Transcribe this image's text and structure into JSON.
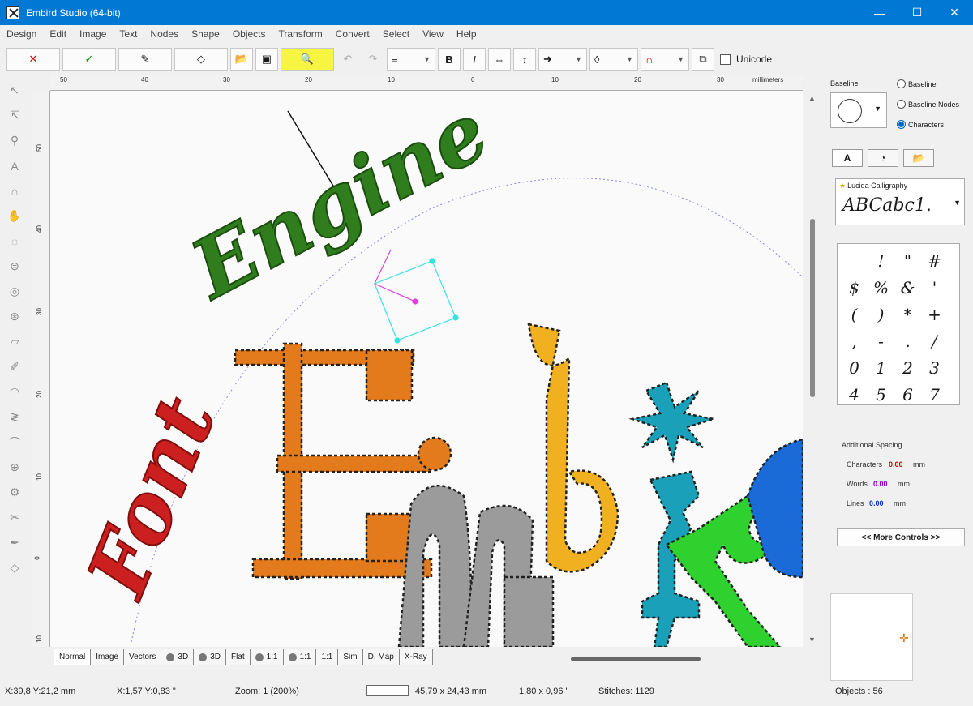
{
  "window": {
    "title": "Embird Studio (64-bit)",
    "minimize": "—",
    "maximize": "☐",
    "close": "✕"
  },
  "menu": [
    "Design",
    "Edit",
    "Image",
    "Text",
    "Nodes",
    "Shape",
    "Objects",
    "Transform",
    "Convert",
    "Select",
    "View",
    "Help"
  ],
  "toolbar": {
    "cancel": "✕",
    "confirm": "✓",
    "unicode_label": "Unicode",
    "bold": "B",
    "italic": "I"
  },
  "ruler": {
    "top_labels": [
      "50",
      "40",
      "30",
      "20",
      "10",
      "0",
      "10",
      "20",
      "30"
    ],
    "unit": "millimeters",
    "left_labels": [
      "50",
      "40",
      "30",
      "20",
      "10",
      "0",
      "10"
    ]
  },
  "canvas_text": {
    "engine": "Engine",
    "font": "Font"
  },
  "view_tabs": [
    "Normal",
    "Image",
    "Vectors",
    "3D",
    "3D",
    "Flat",
    "1:1",
    "1:1",
    "1:1",
    "Sim",
    "D. Map",
    "X-Ray"
  ],
  "right_panel": {
    "baseline_label": "Baseline",
    "radio_options": [
      {
        "label": "Baseline",
        "checked": false
      },
      {
        "label": "Baseline Nodes",
        "checked": false
      },
      {
        "label": "Characters",
        "checked": true
      }
    ],
    "font_name": "Lucida Calligraphy",
    "font_sample": "ABCabc1.",
    "characters": [
      "!",
      "\"",
      "#",
      "$",
      "%",
      "&",
      "'",
      "(",
      ")",
      "*",
      "+",
      ",",
      "-",
      ".",
      "/",
      "0",
      "1",
      "2",
      "3",
      "4",
      "5",
      "6",
      "7"
    ],
    "additional_spacing_label": "Additional Spacing",
    "spacing": [
      {
        "label": "Characters",
        "value": "0.00",
        "unit": "mm",
        "color": "#cc0000"
      },
      {
        "label": "Words",
        "value": "0.00",
        "unit": "mm",
        "color": "#8800cc"
      },
      {
        "label": "Lines",
        "value": "0.00",
        "unit": "mm",
        "color": "#0033cc"
      }
    ],
    "more_controls": "<< More Controls >>"
  },
  "status": {
    "xy": "X:39,8  Y:21,2 mm",
    "sep": "|",
    "xy2": "X:1,57  Y:0,83 \"",
    "zoom": "Zoom:  1 (200%)",
    "size_mm": "45,79 x 24,43 mm",
    "size_in": "1,80 x 0,96 \"",
    "stitches": "Stitches:  1129",
    "objects": "Objects : 56"
  }
}
